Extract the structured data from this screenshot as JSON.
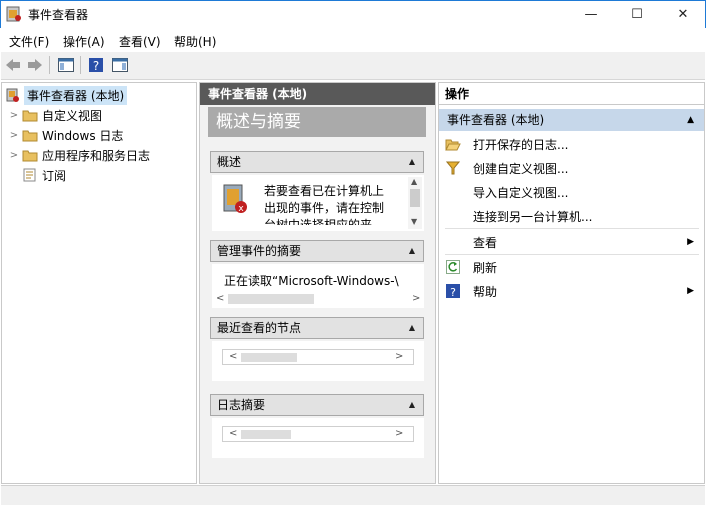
{
  "window": {
    "title": "事件查看器",
    "min": "—",
    "max": "☐",
    "close": "✕"
  },
  "menu": [
    "文件(F)",
    "操作(A)",
    "查看(V)",
    "帮助(H)"
  ],
  "tree": [
    {
      "label": "事件查看器 (本地)",
      "selected": true
    },
    {
      "label": "自定义视图"
    },
    {
      "label": "Windows 日志"
    },
    {
      "label": "应用程序和服务日志"
    },
    {
      "label": "订阅"
    }
  ],
  "middle": {
    "header": "事件查看器 (本地)",
    "title": "概述与摘要",
    "overview": {
      "head": "概述",
      "text": [
        "若要查看已在计算机上",
        "出现的事件，请在控制",
        "台树中选择相应的来"
      ]
    },
    "summary": {
      "head": "管理事件的摘要",
      "text": "正在读取“Microsoft-Windows-\\"
    },
    "recent": {
      "head": "最近查看的节点"
    },
    "logs": {
      "head": "日志摘要"
    }
  },
  "actions": {
    "header": "操作",
    "sub": "事件查看器 (本地)",
    "items": [
      "打开保存的日志...",
      "创建自定义视图...",
      "导入自定义视图...",
      "连接到另一台计算机...",
      "查看",
      "刷新",
      "帮助"
    ]
  }
}
